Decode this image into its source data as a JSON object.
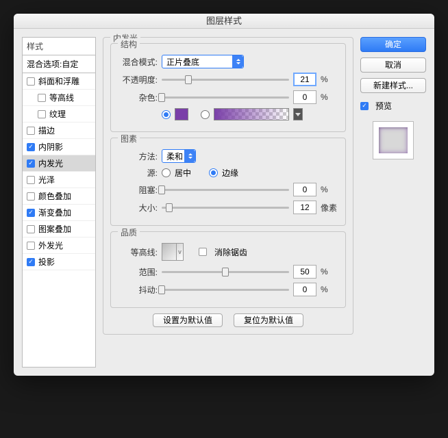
{
  "title": "图层样式",
  "left": {
    "styles_header": "样式",
    "blend_options": "混合选项:自定",
    "items": [
      {
        "label": "斜面和浮雕",
        "checked": false,
        "selected": false,
        "indent": false
      },
      {
        "label": "等高线",
        "checked": false,
        "selected": false,
        "indent": true
      },
      {
        "label": "纹理",
        "checked": false,
        "selected": false,
        "indent": true
      },
      {
        "label": "描边",
        "checked": false,
        "selected": false,
        "indent": false
      },
      {
        "label": "内阴影",
        "checked": true,
        "selected": false,
        "indent": false
      },
      {
        "label": "内发光",
        "checked": true,
        "selected": true,
        "indent": false
      },
      {
        "label": "光泽",
        "checked": false,
        "selected": false,
        "indent": false
      },
      {
        "label": "颜色叠加",
        "checked": false,
        "selected": false,
        "indent": false
      },
      {
        "label": "渐变叠加",
        "checked": true,
        "selected": false,
        "indent": false
      },
      {
        "label": "图案叠加",
        "checked": false,
        "selected": false,
        "indent": false
      },
      {
        "label": "外发光",
        "checked": false,
        "selected": false,
        "indent": false
      },
      {
        "label": "投影",
        "checked": true,
        "selected": false,
        "indent": false
      }
    ]
  },
  "panel_title": "内发光",
  "structure": {
    "legend": "结构",
    "blend_mode_label": "混合模式:",
    "blend_mode_value": "正片叠底",
    "opacity_label": "不透明度:",
    "opacity_value": "21",
    "opacity_unit": "%",
    "noise_label": "杂色:",
    "noise_value": "0",
    "noise_unit": "%",
    "color_selected": true,
    "gradient_selected": false
  },
  "elements": {
    "legend": "图素",
    "method_label": "方法:",
    "method_value": "柔和",
    "source_label": "源:",
    "source_center": "居中",
    "source_edge": "边缘",
    "source_value": "edge",
    "choke_label": "阻塞:",
    "choke_value": "0",
    "choke_unit": "%",
    "size_label": "大小:",
    "size_value": "12",
    "size_unit": "像素"
  },
  "quality": {
    "legend": "品质",
    "contour_label": "等高线:",
    "antialias_label": "消除锯齿",
    "antialias_checked": false,
    "range_label": "范围:",
    "range_value": "50",
    "range_unit": "%",
    "jitter_label": "抖动:",
    "jitter_value": "0",
    "jitter_unit": "%"
  },
  "bottom_buttons": {
    "make_default": "设置为默认值",
    "reset_default": "复位为默认值"
  },
  "right": {
    "ok": "确定",
    "cancel": "取消",
    "new_style": "新建样式...",
    "preview_label": "预览",
    "preview_checked": true
  }
}
